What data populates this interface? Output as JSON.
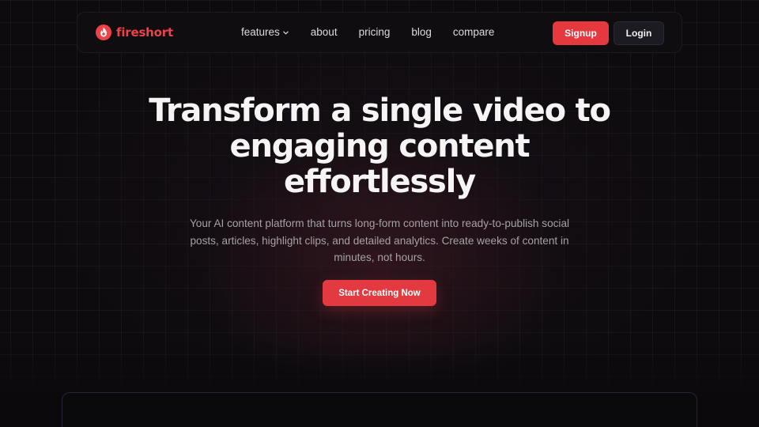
{
  "brand": {
    "name": "fireshort",
    "accent_color": "#ef4148",
    "icon": "flame-logo-icon"
  },
  "nav": {
    "items": [
      {
        "label": "features",
        "has_dropdown": true,
        "icon": "chevron-down-icon"
      },
      {
        "label": "about"
      },
      {
        "label": "pricing"
      },
      {
        "label": "blog"
      },
      {
        "label": "compare"
      }
    ],
    "signup_label": "Signup",
    "login_label": "Login"
  },
  "hero": {
    "title_lines": [
      "Transform a single video to",
      "engaging content",
      "effortlessly"
    ],
    "subtitle": "Your AI content platform that turns long-form content into ready-to-publish social posts, articles, highlight clips, and detailed analytics. Create weeks of content in minutes, not hours.",
    "cta_label": "Start Creating Now"
  },
  "colors": {
    "background": "#0d0b0e",
    "primary_button": "#e5393f",
    "secondary_button": "#1c1b22"
  }
}
